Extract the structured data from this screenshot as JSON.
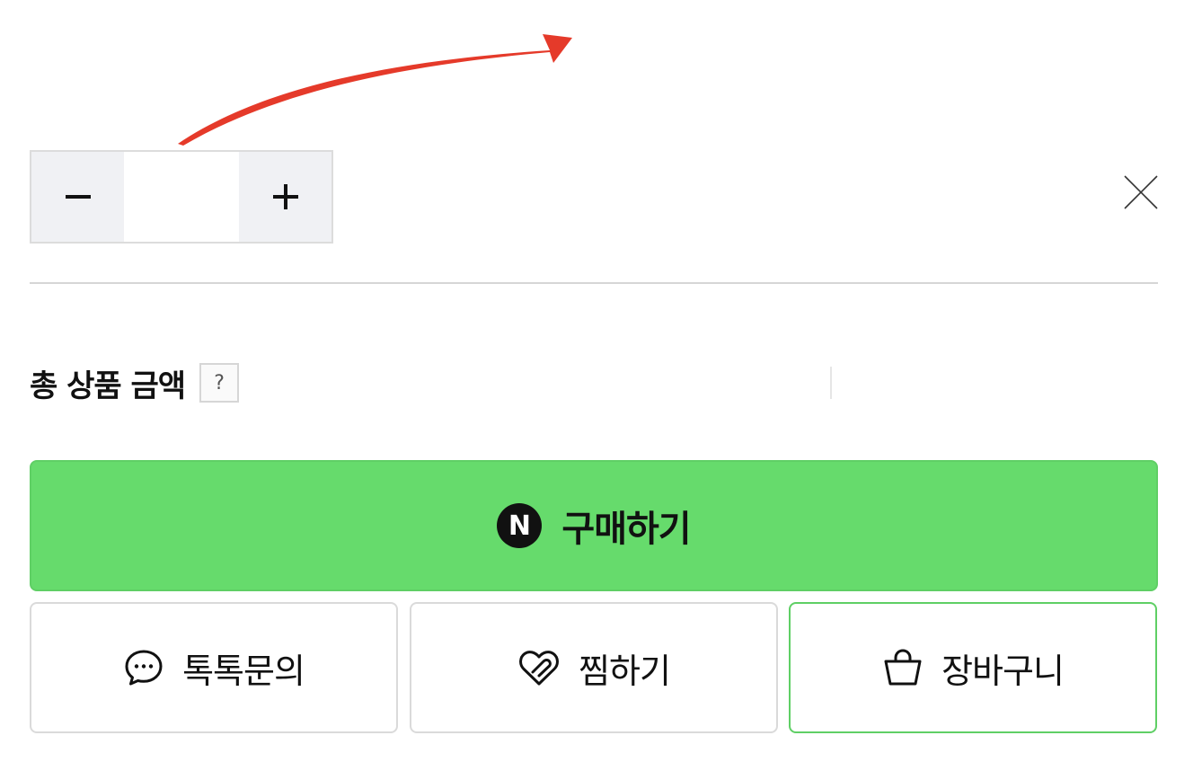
{
  "annotation": {
    "arrow_color": "#e53a2a"
  },
  "quantity": {
    "decrease_label": "−",
    "increase_label": "+",
    "value": ""
  },
  "remove_icon": "close-icon",
  "total": {
    "label": "총 상품 금액",
    "help_label": "?",
    "amount": ""
  },
  "buy": {
    "badge": "N",
    "label": "구매하기",
    "color": "#66db6c"
  },
  "actions": {
    "talk": {
      "label": "톡톡문의",
      "icon": "chat-bubble-icon"
    },
    "wish": {
      "label": "찜하기",
      "icon": "heart-icon"
    },
    "cart": {
      "label": "장바구니",
      "icon": "shopping-bag-icon"
    }
  }
}
